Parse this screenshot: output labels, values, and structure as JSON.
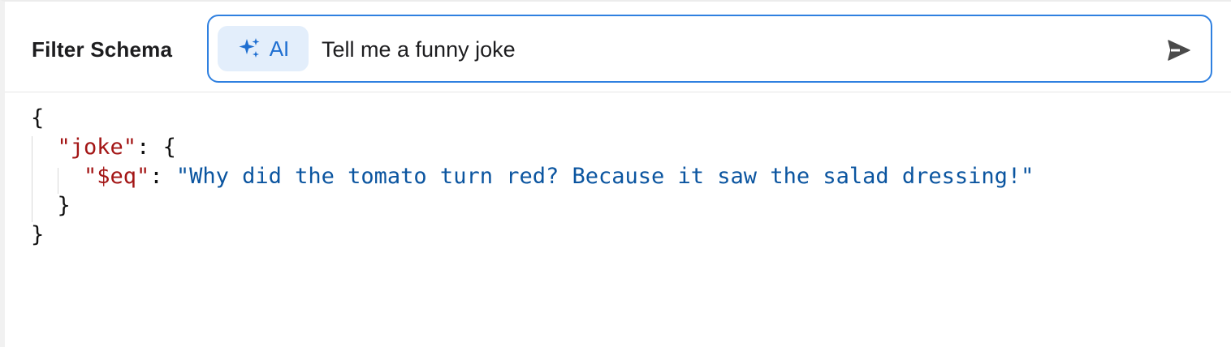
{
  "header": {
    "title": "Filter Schema"
  },
  "search": {
    "ai_label": "AI",
    "ai_icon": "sparkles-icon",
    "query": "Tell me a funny joke",
    "send_icon": "send-icon",
    "accent_color": "#2f80e0"
  },
  "code": {
    "open_brace": "{",
    "key": "\"joke\"",
    "key_suffix": ": {",
    "inner_key": "\"$eq\"",
    "inner_sep": ": ",
    "inner_value": "\"Why did the tomato turn red? Because it saw the salad dressing!\"",
    "inner_close": "}",
    "close_brace": "}",
    "key_color": "#a31515",
    "string_color": "#0b55a0"
  }
}
